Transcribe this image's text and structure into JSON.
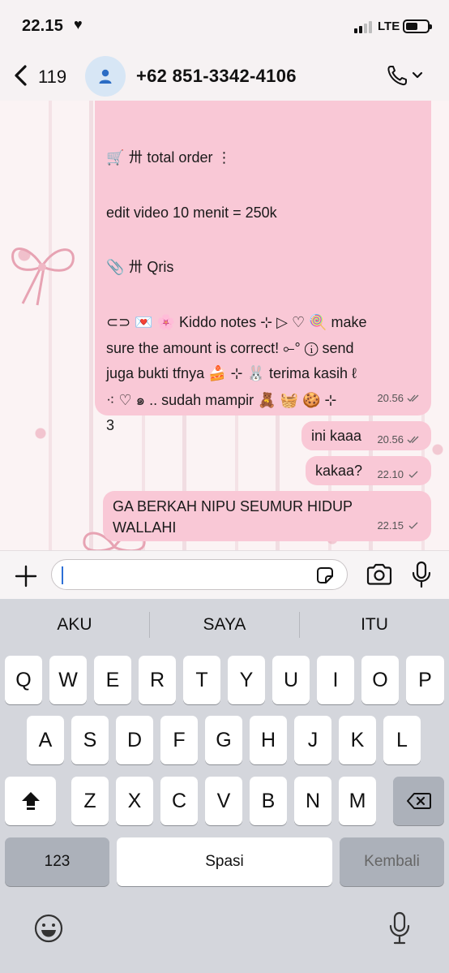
{
  "status_bar": {
    "time": "22.15",
    "time_suffix": "♥",
    "network": "LTE",
    "battery_level": 0.55
  },
  "header": {
    "back_count": "119",
    "contact_name": "+62 851-3342-4106"
  },
  "messages": [
    {
      "direction": "incoming",
      "lines": [
        "🛒 〺 total order ⋮",
        "edit video 10 menit = 250k",
        "📎 〺 Qris",
        "⊂⊃ 💌 🌸 Kiddo notes ⊹ ▷ ♡ 🍭 make",
        "sure the amount is correct! ⟜° ⓘ send",
        "juga bukti tfnya 🍰 ⊹ 🐰 terima kasih ℓ",
        "⁖ ♡ ๑ .. sudah mampir 🧸 🧺 🍪 ⊹ 3"
      ],
      "time": "20.56",
      "status": "read"
    },
    {
      "direction": "incoming",
      "text": "ini kaaa",
      "time": "20.56",
      "status": "read"
    },
    {
      "direction": "incoming",
      "text": "kakaa?",
      "time": "22.10",
      "status": "sent"
    },
    {
      "direction": "incoming",
      "lines": [
        "GA BERKAH NIPU SEUMUR HIDUP",
        "WALLAHI"
      ],
      "time": "22.15",
      "status": "sent"
    }
  ],
  "input": {
    "placeholder": ""
  },
  "keyboard": {
    "suggestions": [
      "AKU",
      "SAYA",
      "ITU"
    ],
    "row1": [
      "Q",
      "W",
      "E",
      "R",
      "T",
      "Y",
      "U",
      "I",
      "O",
      "P"
    ],
    "row2": [
      "A",
      "S",
      "D",
      "F",
      "G",
      "H",
      "J",
      "K",
      "L"
    ],
    "row3": [
      "Z",
      "X",
      "C",
      "V",
      "B",
      "N",
      "M"
    ],
    "numbers_label": "123",
    "space_label": "Spasi",
    "return_label": "Kembali"
  },
  "colors": {
    "bubble": "#f9c8d6",
    "avatar_bg": "#d7e6f5",
    "caret": "#2d6fd6"
  }
}
